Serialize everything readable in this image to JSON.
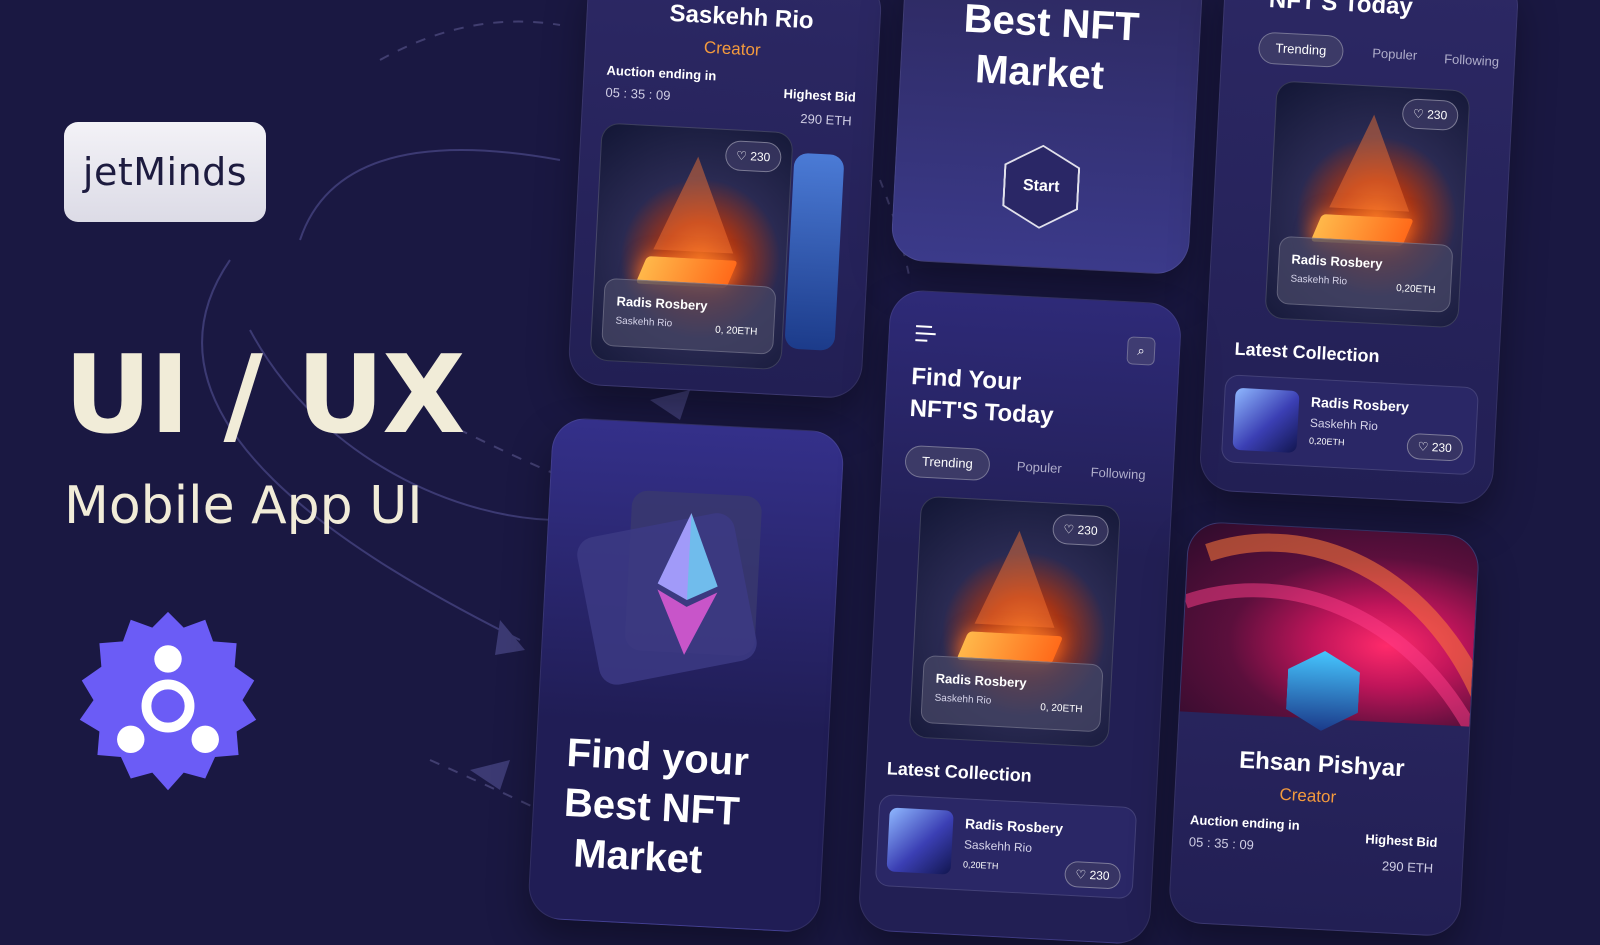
{
  "brand": {
    "name": "jetMinds"
  },
  "hero": {
    "title": "UI / UX",
    "subtitle": "Mobile App UI"
  },
  "shared": {
    "artwork_title": "Radis Rosbery",
    "artwork_creator": "Saskehh Rio",
    "artwork_price_spaced": "0, 20ETH",
    "artwork_price": "0,20ETH",
    "likes": "230",
    "latest_collection": "Latest Collection",
    "creator_label": "Creator",
    "auction_label": "Auction ending in",
    "highest_bid_label": "Highest Bid",
    "timer": "05 : 35 : 09",
    "bid_value": "290 ETH"
  },
  "tabs": [
    "Trending",
    "Populer",
    "Following"
  ],
  "screen_profile_top": {
    "name": "Saskehh Rio"
  },
  "screen_start": {
    "title_line1": "Best NFT",
    "title_line2": "Market",
    "start_button": "Start"
  },
  "screen_trending_top": {
    "title_partial": "NFT'S Today"
  },
  "screen_onboarding": {
    "line1": "Find your",
    "line2": "Best NFT",
    "line3": "Market"
  },
  "screen_home": {
    "line1": "Find Your",
    "line2": "NFT'S Today"
  },
  "screen_profile_bottom": {
    "name": "Ehsan Pishyar"
  },
  "colors": {
    "background": "#1a1842",
    "accent_orange": "#f49a3d",
    "logo_purple": "#6b5cf6",
    "hero_text": "#f1ecd8"
  }
}
